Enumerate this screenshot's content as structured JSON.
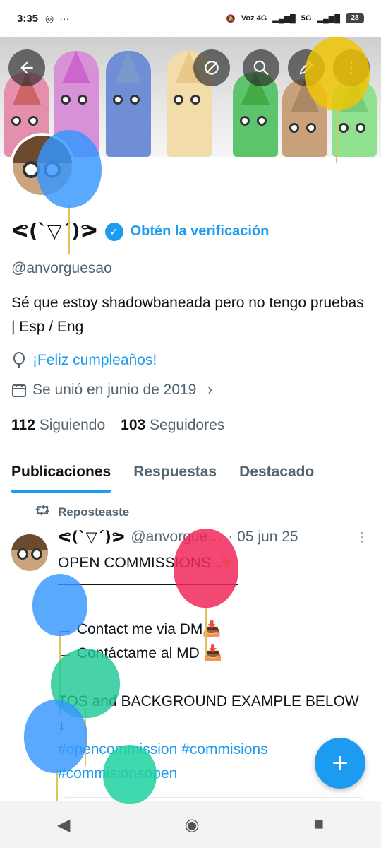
{
  "status_bar": {
    "time": "3:35",
    "network": "Voz 4G",
    "signal2": "5G",
    "battery": "28"
  },
  "header": {
    "back_icon": "back-arrow-icon",
    "more_icons": [
      "no-image-icon",
      "search-icon",
      "edit-icon",
      "more-vertical-icon"
    ]
  },
  "profile": {
    "name": "ᕙ(`▽´)ᕗ",
    "verify_cta": "Obtén la verificación",
    "handle": "@anvorguesao",
    "bio": "Sé que estoy shadowbaneada pero no tengo pruebas | Esp / Eng",
    "birthday": "¡Feliz cumpleaños!",
    "joined": "Se unió en junio de 2019",
    "following_count": "112",
    "following_label": "Siguiendo",
    "followers_count": "103",
    "followers_label": "Seguidores"
  },
  "tabs": [
    {
      "label": "Publicaciones",
      "active": true
    },
    {
      "label": "Respuestas",
      "active": false
    },
    {
      "label": "Destacado",
      "active": false
    }
  ],
  "post": {
    "repost_label": "Reposteaste",
    "author_name": "ᕙ(`▽´)ᕗ",
    "author_handle": "@anvorguesao",
    "date": "· 05 jun 25",
    "line1": "OPEN COMMISSIONS ✨",
    "line2": "→ Contact me via DM📥",
    "line3": "→ Contáctame al MD 📥",
    "line4": "TOS and BACKGROUND EXAMPLE BELOW ↓",
    "tags": "#opencommission #commisions #commisionsopen"
  },
  "fab_label": "+",
  "navbar": {
    "back": "◀",
    "home": "◉",
    "recents": "■"
  },
  "colors": {
    "accent": "#1d9bf0",
    "muted": "#536471"
  }
}
